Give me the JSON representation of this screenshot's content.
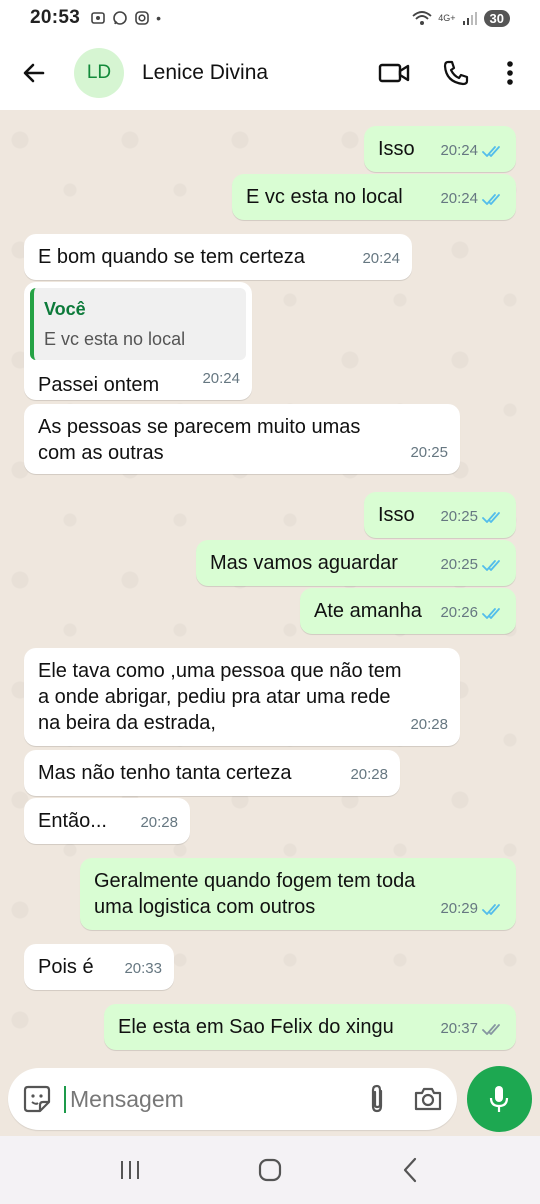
{
  "status_bar": {
    "time": "20:53",
    "dot": "•",
    "network": "4G+",
    "battery": "30"
  },
  "header": {
    "avatar_initials": "LD",
    "contact_name": "Lenice Divina"
  },
  "messages": [
    {
      "dir": "out",
      "text": "Isso",
      "time": "20:24",
      "status": "read"
    },
    {
      "dir": "out",
      "text": "E vc esta no local",
      "time": "20:24",
      "status": "read"
    },
    {
      "dir": "in",
      "text": "E bom quando se tem certeza",
      "time": "20:24"
    },
    {
      "dir": "in",
      "quote_author": "Você",
      "quote_text": "E vc esta no local",
      "text": "Passei ontem",
      "time": "20:24"
    },
    {
      "dir": "in",
      "text": "As pessoas se parecem muito umas\ncom as outras",
      "time": "20:25"
    },
    {
      "dir": "out",
      "text": "Isso",
      "time": "20:25",
      "status": "read"
    },
    {
      "dir": "out",
      "text": "Mas vamos aguardar",
      "time": "20:25",
      "status": "read"
    },
    {
      "dir": "out",
      "text": "Ate amanha",
      "time": "20:26",
      "status": "read"
    },
    {
      "dir": "in",
      "text": "Ele tava como ,uma pessoa que não tem\na onde abrigar, pediu pra atar uma rede\nna beira da estrada,",
      "time": "20:28"
    },
    {
      "dir": "in",
      "text": "Mas não tenho tanta certeza",
      "time": "20:28"
    },
    {
      "dir": "in",
      "text": "Então...",
      "time": "20:28"
    },
    {
      "dir": "out",
      "text": "Geralmente quando fogem tem toda\numa logistica com outros",
      "time": "20:29",
      "status": "read"
    },
    {
      "dir": "in",
      "text": "Pois é",
      "time": "20:33"
    },
    {
      "dir": "out",
      "text": "Ele esta em Sao Felix do xingu",
      "time": "20:37",
      "status": "delivered"
    }
  ],
  "input": {
    "placeholder": "Mensagem"
  },
  "colors": {
    "accent_green": "#1da851",
    "read_tick": "#53bdeb",
    "delivered_tick": "#8696a0",
    "outgoing_bubble": "#d9fdd3",
    "incoming_bubble": "#ffffff",
    "chat_background": "#efe7de"
  },
  "icons": {
    "back": "arrow-left-icon",
    "video": "video-call-icon",
    "voice": "phone-icon",
    "menu": "more-vert-icon",
    "sticker": "sticker-icon",
    "attach": "paperclip-icon",
    "camera": "camera-icon",
    "mic": "mic-icon"
  }
}
